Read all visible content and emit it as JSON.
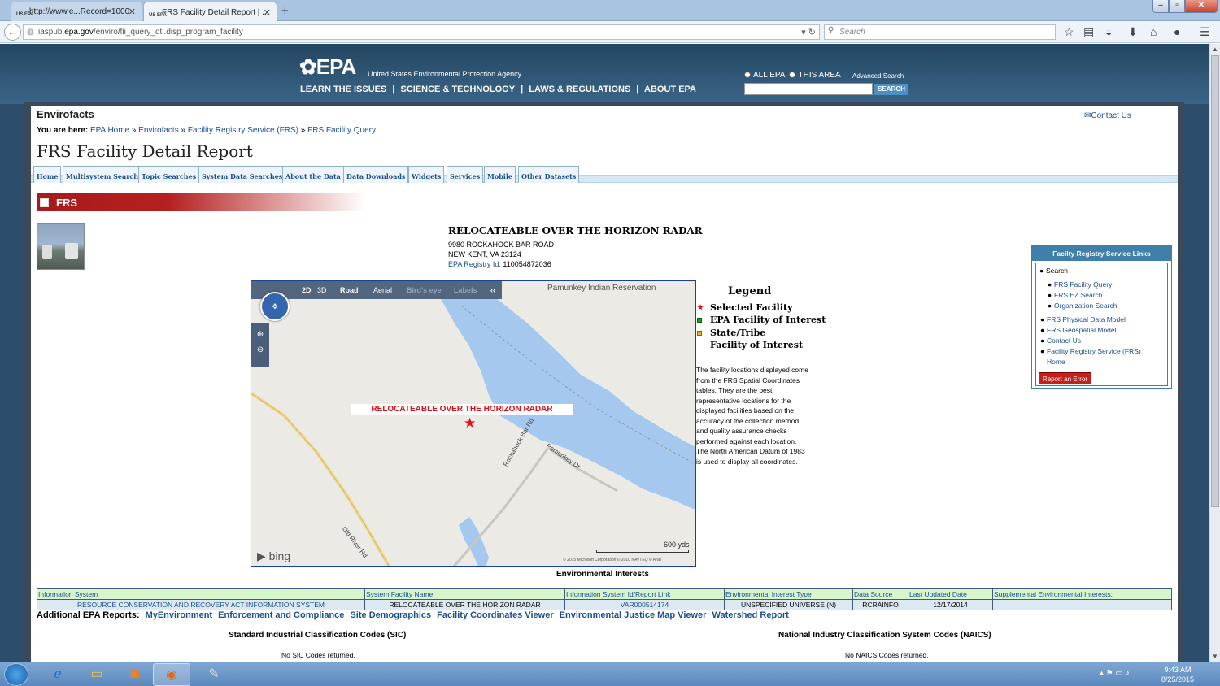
{
  "browser": {
    "tabs": [
      {
        "label": "http://www.e...Record=1000",
        "fav": "US EPA"
      },
      {
        "label": "FRS Facility Detail Report | ...",
        "fav": "US EPA"
      }
    ],
    "url_prefix": "iaspub.",
    "url_host": "epa.gov",
    "url_path": "/enviro/fii_query_dtl.disp_program_facility",
    "search_placeholder": "Search"
  },
  "header": {
    "logo": "EPA",
    "tagline": "United States Environmental Protection Agency",
    "nav": [
      "LEARN THE ISSUES",
      "SCIENCE & TECHNOLOGY",
      "LAWS & REGULATIONS",
      "ABOUT EPA"
    ],
    "scope_all": "ALL EPA",
    "scope_area": "THIS AREA",
    "advanced": "Advanced Search",
    "search_button": "SEARCH"
  },
  "site": {
    "title": "Envirofacts",
    "contact": "Contact Us",
    "crumbs_label": "You are here:",
    "crumbs": [
      "EPA Home",
      "Envirofacts",
      "Facility Registry Service (FRS)",
      "FRS Facility Query"
    ],
    "page_title": "FRS Facility Detail Report",
    "tabs": [
      "Home",
      "Multisystem Search",
      "Topic Searches",
      "System Data Searches",
      "About the Data",
      "Data Downloads",
      "Widgets",
      "Services",
      "Mobile",
      "Other Datasets"
    ],
    "section": "FRS"
  },
  "facility": {
    "name": "RELOCATEABLE OVER THE HORIZON RADAR",
    "addr1": "9980 ROCKAHOCK BAR ROAD",
    "addr2": "NEW KENT, VA 23124",
    "id_label": "EPA Registry Id:",
    "id": "110054872036"
  },
  "map": {
    "modes": [
      "2D",
      "3D",
      "Road",
      "Aerial",
      "Bird's eye",
      "Labels",
      "‹‹"
    ],
    "reservation": "Pamunkey Indian Reservation",
    "marker_label": "RELOCATEABLE OVER THE HORIZON RADAR",
    "roads": {
      "rockahock": "Rockahock Bar Rd",
      "pamunkey": "Pamunkey Dr",
      "oldriver": "Old River Rd"
    },
    "scale": "600 yds",
    "brand": "bing",
    "copyright": "© 2015 Microsoft Corporation  © 2010 NAVTEQ  © AND"
  },
  "legend": {
    "title": "Legend",
    "items": [
      "Selected Facility",
      "EPA Facility of Interest",
      "State/Tribe",
      "Facility of Interest"
    ],
    "text": "The facility locations displayed come from the FRS Spatial Coordinates tables. They are the best representative locations for the displayed facilities based on the accuracy of the collection method and quality assurance checks performed against each location. The North American Datum of 1983 is used to display all coordinates."
  },
  "env": {
    "title": "Environmental Interests",
    "headers": [
      "Information System",
      "System Facility Name",
      "Information System Id/Report Link",
      "Environmental Interest Type",
      "Data Source",
      "Last Updated Date",
      "Supplemental Environmental Interests:"
    ],
    "row": [
      "RESOURCE CONSERVATION AND RECOVERY ACT INFORMATION SYSTEM",
      "RELOCATEABLE OVER THE HORIZON RADAR",
      "VAR000514174",
      "UNSPECIFIED UNIVERSE (N)",
      "RCRAINFO",
      "12/17/2014",
      ""
    ]
  },
  "additional": {
    "label": "Additional EPA Reports:",
    "links": [
      "MyEnvironment",
      "Enforcement and Compliance",
      "Site Demographics",
      "Facility Coordinates Viewer",
      "Environmental Justice Map Viewer",
      "Watershed Report"
    ]
  },
  "codes": {
    "sic_title": "Standard Industrial Classification Codes (SIC)",
    "naics_title": "National Industry Classification System Codes (NAICS)",
    "sic_none": "No SIC Codes returned.",
    "naics_none": "No NAICS Codes returned."
  },
  "links_box": {
    "title": "Facilty Registry Service Links",
    "search": "Search",
    "items": [
      "FRS Facility Query",
      "FRS EZ Search",
      "Organization Search",
      "FRS Physical Data Model",
      "FRS Geospatial Model",
      "Contact Us",
      "Facility Registry Service (FRS)",
      "Home"
    ],
    "report": "Report an Error"
  },
  "taskbar": {
    "time": "9:43 AM",
    "date": "8/25/2015"
  }
}
